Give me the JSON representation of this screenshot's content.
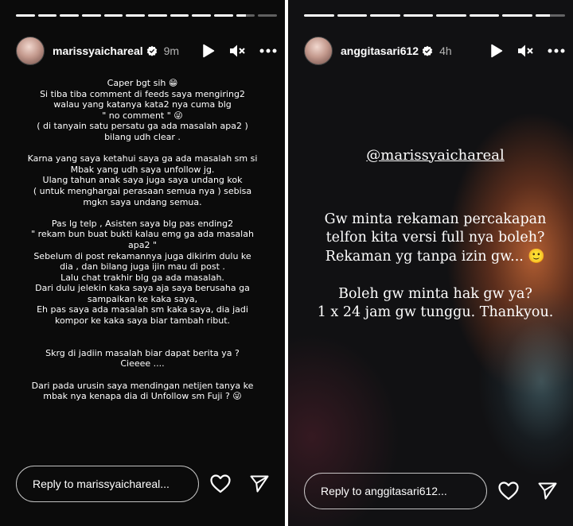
{
  "left_story": {
    "progress": [
      1,
      1,
      1,
      1,
      1,
      1,
      1,
      1,
      1,
      1,
      0.5,
      0
    ],
    "username": "marissyaichareal",
    "time": "9m",
    "text": "Caper bgt sih 😁\nSi tiba tiba comment di feeds saya mengiring2\nwalau yang katanya kata2 nya cuma blg\n\" no comment \" 😜\n( di tanyain satu persatu ga ada masalah apa2 )\nbilang udh clear .\n\nKarna yang saya ketahui saya ga ada masalah sm si\nMbak yang udh saya unfollow jg.\nUlang tahun anak saya juga saya undang kok\n( untuk menghargai perasaan semua nya ) sebisa\nmgkn saya undang semua.\n\nPas lg telp , Asisten saya blg pas ending2\n\" rekam bun buat bukti kalau emg ga ada masalah\napa2 \"\nSebelum di post rekamannya juga dikirim dulu ke\ndia , dan bilang juga ijin mau di post .\nLalu chat trakhir blg ga ada masalah.\nDari dulu jelekin kaka saya aja saya berusaha ga\nsampaikan ke kaka saya,\nEh pas saya ada masalah sm kaka saya, dia jadi\nkompor ke kaka saya biar tambah ribut.\n\n\nSkrg di jadiin masalah biar dapat berita ya ?\nCieeee ....\n\nDari pada urusin saya mendingan netijen tanya ke\nmbak nya kenapa dia di Unfollow sm Fuji ? 😜",
    "reply_placeholder": "Reply to marissyaichareal..."
  },
  "right_story": {
    "progress": [
      1,
      1,
      1,
      1,
      1,
      1,
      1,
      0.5
    ],
    "username": "anggitasari612",
    "time": "4h",
    "mention": "@marissyaichareal",
    "text": "Gw minta rekaman percakapan\ntelfon kita versi full nya boleh?\nRekaman yg tanpa izin gw... 🙂\n\nBoleh gw minta hak gw ya?\n1 x 24 jam gw tunggu. Thankyou.",
    "reply_placeholder": "Reply to anggitasari612..."
  },
  "icons": [
    "verified-badge-icon",
    "play-icon",
    "mute-icon",
    "more-icon",
    "heart-icon",
    "send-icon"
  ],
  "colors": {
    "verified": "#3897f0",
    "background": "#0b0b0b",
    "text": "#ffffff"
  }
}
